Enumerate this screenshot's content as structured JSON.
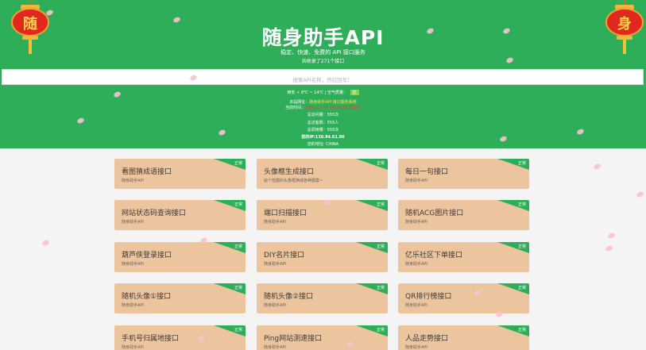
{
  "header": {
    "title": "随身助手API",
    "subtitle": "稳定、快速、免费的 API 接口服务",
    "count_text": "共收录了271个接口"
  },
  "lanterns": {
    "left_char": "随",
    "right_char": "身"
  },
  "search": {
    "placeholder": "搜索API名称，然后回车！"
  },
  "weather": {
    "city": "西安",
    "temp": "8℃ ~ 14℃",
    "aqi_label": "空气质量：",
    "aqi_value": "优"
  },
  "stats": {
    "notice_label": "本站网址：",
    "notice_value": "随身助手API 接口服务系统",
    "time_label": "当前时间：",
    "time_value": "2023-03-04 14:24:55 星期六",
    "total_calls": "总访问量：555次",
    "today_calls": "总访客数：555人",
    "api_count": "总调用量：555次",
    "your_ip": "您的IP:130.84.61.86",
    "your_location": "您的地址: CHINA"
  },
  "badge_text": "正常",
  "cards": [
    {
      "title": "看图猜成语接口",
      "desc": "随身助手API"
    },
    {
      "title": "头像框生成接口",
      "desc": "给个性图的头像框换成各种图案~"
    },
    {
      "title": "每日一句接口",
      "desc": "随身助手API"
    },
    {
      "title": "网站状态码查询接口",
      "desc": "随身助手API"
    },
    {
      "title": "端口扫描接口",
      "desc": "随身助手API"
    },
    {
      "title": "随机ACG图片接口",
      "desc": "随身助手API"
    },
    {
      "title": "葫芦侠登录接口",
      "desc": "随身助手API"
    },
    {
      "title": "DIY名片接口",
      "desc": "随身助手API"
    },
    {
      "title": "亿乐社区下单接口",
      "desc": "随身助手API"
    },
    {
      "title": "随机头像①接口",
      "desc": "随身助手API"
    },
    {
      "title": "随机头像②接口",
      "desc": "随身助手API"
    },
    {
      "title": "QR排行榜接口",
      "desc": "随身助手API"
    },
    {
      "title": "手机号归属地接口",
      "desc": "随身助手API"
    },
    {
      "title": "Ping网站测速接口",
      "desc": "随身助手API"
    },
    {
      "title": "人品走势接口",
      "desc": "随身助手API"
    }
  ],
  "colors": {
    "header_green": "#2fae5a",
    "card_bg": "#ecc49e",
    "badge_green": "#2fae5a",
    "petal_pink": "#f7c3ce",
    "lantern_red": "#e0281e"
  }
}
